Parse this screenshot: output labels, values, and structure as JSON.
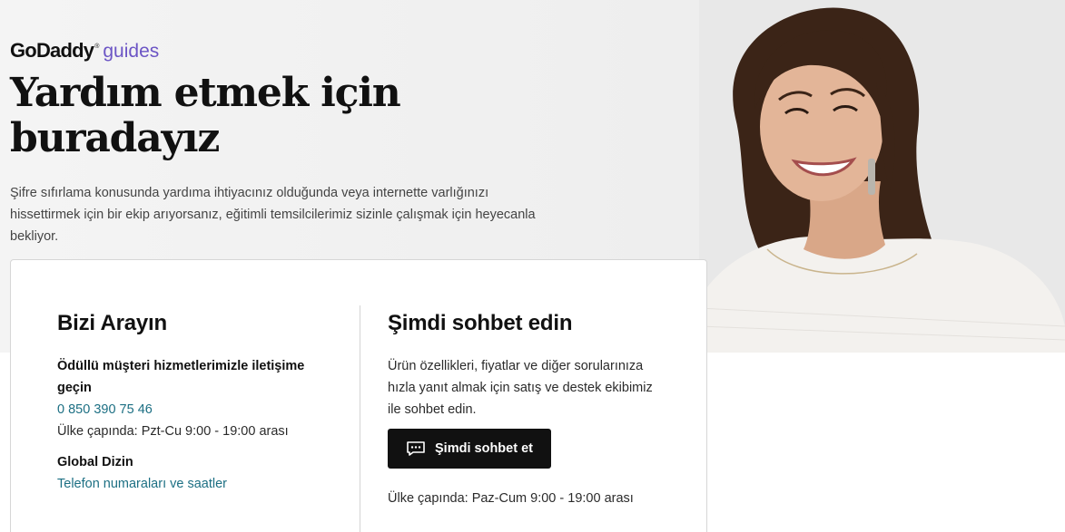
{
  "brand": {
    "logo": "GoDaddy",
    "trademark": "®",
    "sub": "guides"
  },
  "hero": {
    "title": "Yardım etmek için buradayız",
    "description": "Şifre sıfırlama konusunda yardıma ihtiyacınız olduğunda veya internette varlığınızı hissettirmek için bir ekip arıyorsanız, eğitimli temsilcilerimiz sizinle çalışmak için heyecanla bekliyor."
  },
  "call": {
    "heading": "Bizi Arayın",
    "subheading": "Ödüllü müşteri hizmetlerimizle iletişime geçin",
    "phone": "0 850 390 75 46",
    "hours": "Ülke çapında: Pzt-Cu 9:00 - 19:00 arası",
    "global_heading": "Global Dizin",
    "global_link": "Telefon numaraları ve saatler"
  },
  "chat": {
    "heading": "Şimdi sohbet edin",
    "description": "Ürün özellikleri, fiyatlar ve diğer sorularınıza hızla yanıt almak için satış ve destek ekibimiz ile sohbet edin.",
    "button_label": "Şimdi sohbet et",
    "button_icon": "chat-icon",
    "hours": "Ülke çapında: Paz-Cum 9:00 - 19:00 arası"
  },
  "colors": {
    "brand_purple": "#6c55c5",
    "link_teal": "#1c6f83",
    "button_black": "#111111"
  }
}
